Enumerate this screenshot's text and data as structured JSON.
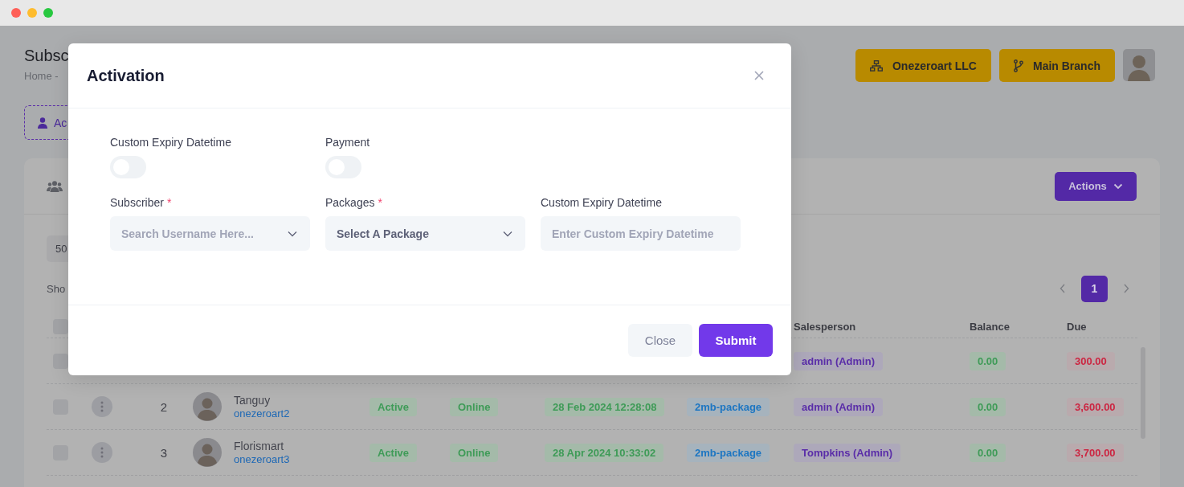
{
  "page": {
    "title": "Subsc",
    "breadcrumb": "Home -",
    "add_button": "Ac",
    "company_button": "Onezeroart LLC",
    "branch_button": "Main Branch"
  },
  "card": {
    "actions_button": "Actions",
    "page_size": "50",
    "showing": "Sho",
    "pagination": [
      {
        "label": "1",
        "selected": true
      }
    ]
  },
  "table": {
    "select_all": {
      "checked": false
    },
    "columns": [
      "Salesperson",
      "Balance",
      "Due"
    ],
    "rows": [
      {
        "checked": false,
        "salesperson": "admin (Admin)",
        "balance": "0.00",
        "due": "300.00"
      },
      {
        "checked": false,
        "number": "2",
        "name": "Tanguy",
        "username": "onezeroart2",
        "status": "Active",
        "connection": "Online",
        "expiry": "28 Feb 2024 12:28:08",
        "package": "2mb-package",
        "salesperson": "admin (Admin)",
        "balance": "0.00",
        "due": "3,600.00"
      },
      {
        "checked": false,
        "number": "3",
        "name": "Florismart",
        "username": "onezeroart3",
        "status": "Active",
        "connection": "Online",
        "expiry": "28 Apr 2024 10:33:02",
        "package": "2mb-package",
        "salesperson": "Tompkins (Admin)",
        "balance": "0.00",
        "due": "3,700.00"
      }
    ]
  },
  "modal": {
    "title": "Activation",
    "toggles": [
      {
        "label": "Custom Expiry Datetime",
        "on": false
      },
      {
        "label": "Payment",
        "on": false
      }
    ],
    "fields": [
      {
        "kind": "select",
        "label": "Subscriber",
        "required_mark": "*",
        "placeholder": "Search Username Here..."
      },
      {
        "kind": "select",
        "label": "Packages",
        "required_mark": "*",
        "value": "Select A Package"
      },
      {
        "kind": "input",
        "label": "Custom Expiry Datetime",
        "placeholder": "Enter Custom Expiry Datetime"
      }
    ],
    "buttons": [
      {
        "kind": "secondary",
        "label": "Close"
      },
      {
        "kind": "primary",
        "label": "Submit"
      }
    ]
  }
}
